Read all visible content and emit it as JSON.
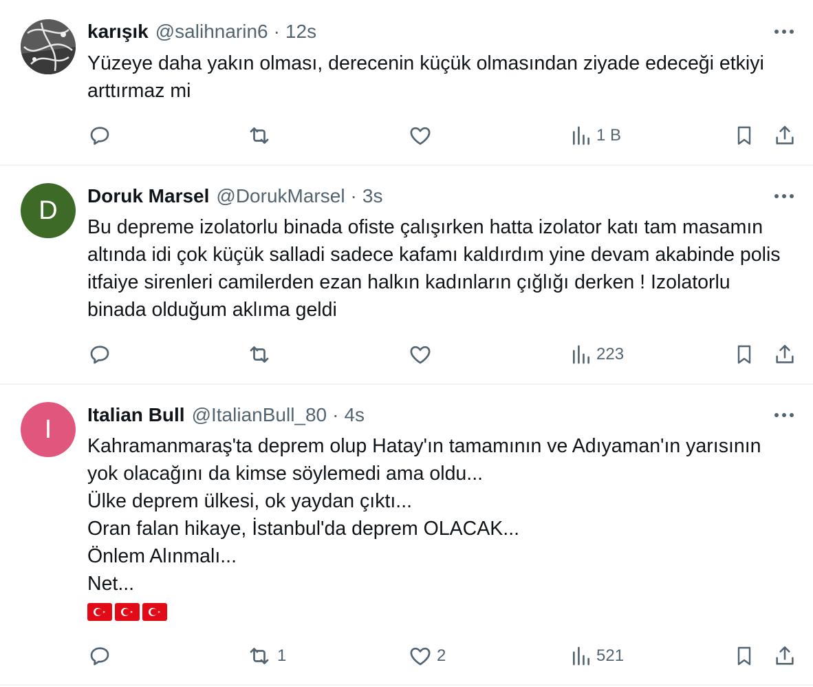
{
  "tweets": [
    {
      "name": "karışık",
      "handle": "@salihnarin6",
      "separator": "·",
      "time": "12s",
      "avatar": {
        "type": "photo",
        "letter": "",
        "color": "#4a4a4a"
      },
      "text": "Yüzeye daha yakın olması, derecenin küçük olmasından ziyade edeceği etkiyi arttırmaz mi",
      "flags": [],
      "actions": {
        "replies": "",
        "retweets": "",
        "likes": "",
        "views": "1 B"
      }
    },
    {
      "name": "Doruk Marsel",
      "handle": "@DorukMarsel",
      "separator": "·",
      "time": "3s",
      "avatar": {
        "type": "letter",
        "letter": "D",
        "color": "#3d6b27"
      },
      "text": "Bu depreme izolatorlu binada ofiste çalışırken hatta izolator katı tam masamın altında idi çok küçük salladi sadece kafamı kaldırdım yine devam akabinde polis itfaiye sirenleri camilerden ezan halkın kadınların çığlığı derken ! Izolatorlu binada olduğum aklıma geldi",
      "flags": [],
      "actions": {
        "replies": "",
        "retweets": "",
        "likes": "",
        "views": "223"
      }
    },
    {
      "name": "Italian Bull",
      "handle": "@ItalianBull_80",
      "separator": "·",
      "time": "4s",
      "avatar": {
        "type": "letter",
        "letter": "I",
        "color": "#e0567d"
      },
      "text": "Kahramanmaraş'ta deprem olup Hatay'ın tamamının ve Adıyaman'ın yarısının yok olacağını da kimse söylemedi ama oldu...\nÜlke deprem ülkesi, ok yaydan çıktı...\nOran falan hikaye, İstanbul'da deprem OLACAK...\nÖnlem Alınmalı...\nNet...",
      "flags": [
        "turkish-flag",
        "turkish-flag",
        "turkish-flag"
      ],
      "actions": {
        "replies": "",
        "retweets": "1",
        "likes": "2",
        "views": "521"
      }
    }
  ],
  "icons": {
    "more": "more-horizontal-icon",
    "reply": "reply-icon",
    "retweet": "retweet-icon",
    "like": "heart-icon",
    "views": "views-chart-icon",
    "bookmark": "bookmark-icon",
    "share": "share-icon"
  },
  "colors": {
    "text": "#0f1419",
    "secondary": "#536471",
    "divider": "#eff3f4",
    "flag_red": "#e30a17"
  }
}
